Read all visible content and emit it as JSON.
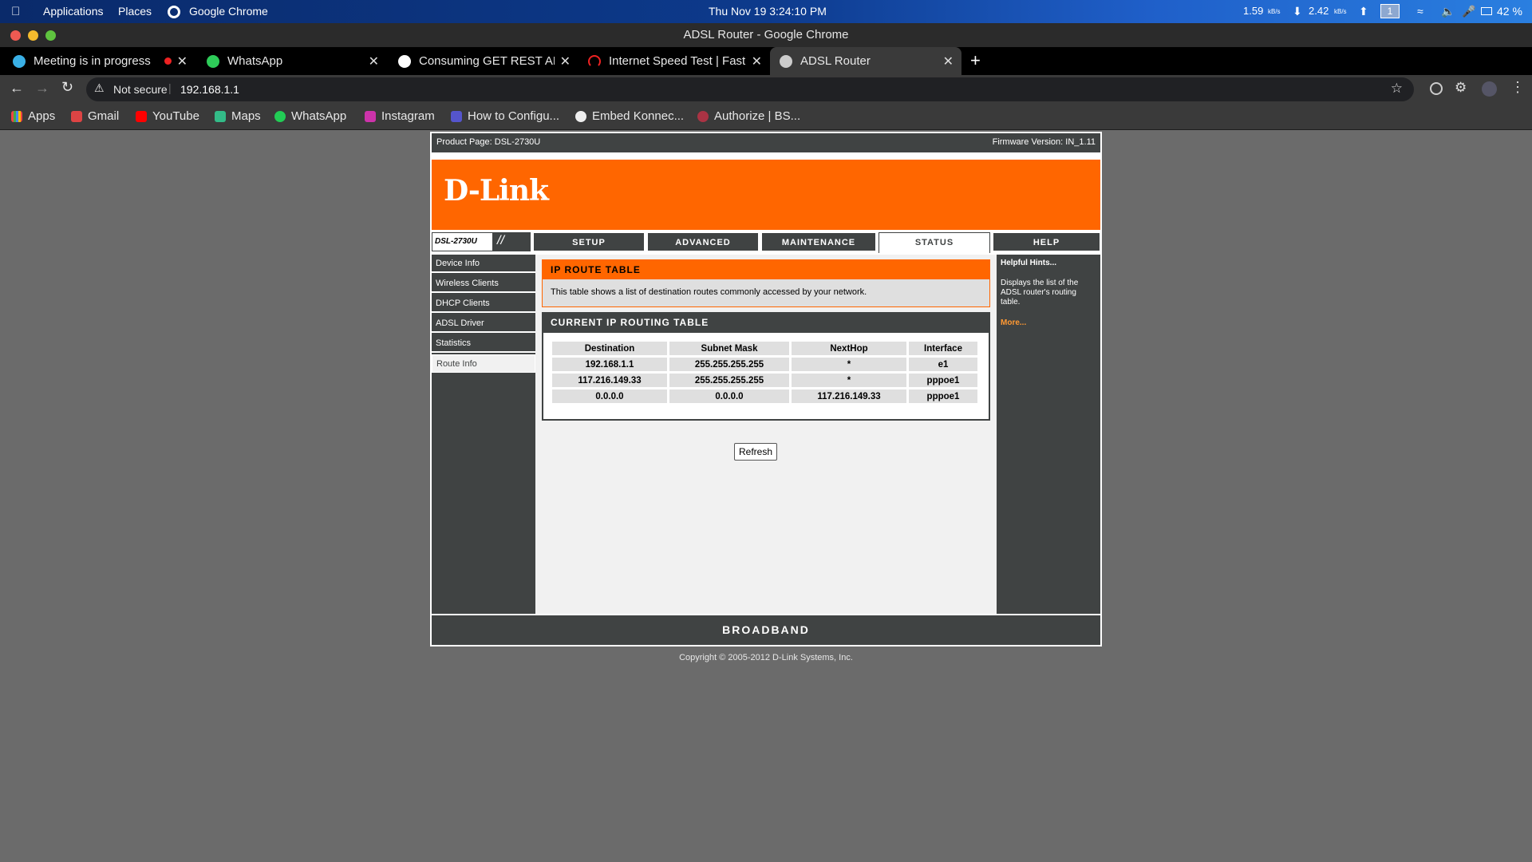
{
  "system_bar": {
    "applications": "Applications",
    "places": "Places",
    "app_name": "Google Chrome",
    "datetime": "Thu Nov 19   3:24:10 PM",
    "net_down": "1.59",
    "net_down_unit": "kB/s",
    "net_up": "2.42",
    "net_up_unit": "kB/s",
    "workspace": "1",
    "battery": "42 %"
  },
  "window": {
    "title": "ADSL Router - Google Chrome"
  },
  "tabs": [
    {
      "title": "Meeting is in progress",
      "active": false
    },
    {
      "title": "WhatsApp",
      "active": false
    },
    {
      "title": "Consuming GET REST API",
      "active": false
    },
    {
      "title": "Internet Speed Test | Fast",
      "active": false
    },
    {
      "title": "ADSL Router",
      "active": true
    }
  ],
  "address_bar": {
    "security": "Not secure",
    "url": "192.168.1.1"
  },
  "bookmarks": [
    "Apps",
    "Gmail",
    "YouTube",
    "Maps",
    "WhatsApp",
    "Instagram",
    "How to Configu...",
    "Embed Konnec...",
    "Authorize | BS..."
  ],
  "router": {
    "product": "Product Page: DSL-2730U",
    "firmware": "Firmware Version: IN_1.11",
    "logo": "D-Link",
    "model": "DSL-2730U",
    "nav_tabs": [
      "SETUP",
      "ADVANCED",
      "MAINTENANCE",
      "STATUS",
      "HELP"
    ],
    "active_tab": "STATUS",
    "left_nav": [
      "Device Info",
      "Wireless Clients",
      "DHCP Clients",
      "ADSL Driver",
      "Statistics",
      "Route Info"
    ],
    "active_left": "Route Info",
    "section1_title": "IP ROUTE TABLE",
    "section1_desc": "This table shows a list of destination routes commonly accessed by your network.",
    "section2_title": "CURRENT IP ROUTING TABLE",
    "table": {
      "headers": [
        "Destination",
        "Subnet Mask",
        "NextHop",
        "Interface"
      ],
      "rows": [
        [
          "192.168.1.1",
          "255.255.255.255",
          "*",
          "e1"
        ],
        [
          "117.216.149.33",
          "255.255.255.255",
          "*",
          "pppoe1"
        ],
        [
          "0.0.0.0",
          "0.0.0.0",
          "117.216.149.33",
          "pppoe1"
        ]
      ]
    },
    "refresh_label": "Refresh",
    "hints_title": "Helpful Hints...",
    "hints_text": "Displays the list of the ADSL router's routing table.",
    "hints_more": "More...",
    "footer": "BROADBAND",
    "copyright": "Copyright © 2005-2012 D-Link Systems, Inc."
  },
  "colors": {
    "brand_orange": "#ff6600",
    "router_gray": "#404343",
    "page_bg": "#6b6b6b"
  }
}
